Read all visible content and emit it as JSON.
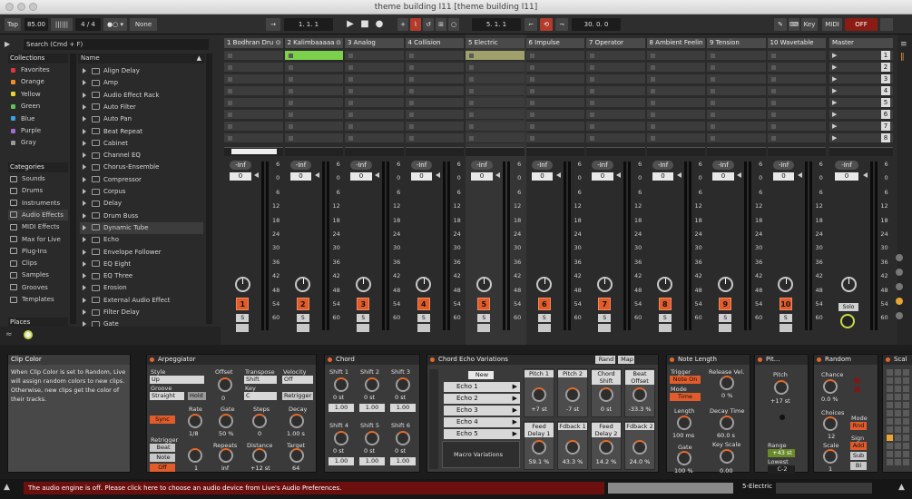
{
  "window": {
    "title": "theme building l11  [theme building l11]"
  },
  "toolbar": {
    "tap": "Tap",
    "tempo": "85.00",
    "signature": "4 / 4",
    "metro": "1 Bar",
    "quant": "None",
    "position": "1.  1.  1",
    "loop_start": "5.  1.  1",
    "loop_len": "30.  0.  0",
    "key": "Key",
    "midi": "MIDI",
    "cpu": "OFF"
  },
  "browser": {
    "search_placeholder": "Search (Cmd + F)",
    "collections_header": "Collections",
    "collections": [
      {
        "label": "Favorites",
        "color": "#e0353a"
      },
      {
        "label": "Orange",
        "color": "#f28c28"
      },
      {
        "label": "Yellow",
        "color": "#e8d234"
      },
      {
        "label": "Green",
        "color": "#5ec15a"
      },
      {
        "label": "Blue",
        "color": "#3aa0e8"
      },
      {
        "label": "Purple",
        "color": "#a56ad6"
      },
      {
        "label": "Gray",
        "color": "#9a9a9a"
      }
    ],
    "categories_header": "Categories",
    "categories": [
      {
        "label": "Sounds",
        "icon": "speaker-icon"
      },
      {
        "label": "Drums",
        "icon": "drum-icon"
      },
      {
        "label": "Instruments",
        "icon": "keyboard-icon"
      },
      {
        "label": "Audio Effects",
        "icon": "waveform-icon"
      },
      {
        "label": "MIDI Effects",
        "icon": "midi-icon"
      },
      {
        "label": "Max for Live",
        "icon": "max-icon"
      },
      {
        "label": "Plug-Ins",
        "icon": "plug-icon"
      },
      {
        "label": "Clips",
        "icon": "clip-icon"
      },
      {
        "label": "Samples",
        "icon": "sample-icon"
      },
      {
        "label": "Grooves",
        "icon": "groove-icon"
      },
      {
        "label": "Templates",
        "icon": "template-icon"
      }
    ],
    "places_header": "Places",
    "name_header": "Name",
    "items": [
      "Align Delay",
      "Amp",
      "Audio Effect Rack",
      "Auto Filter",
      "Auto Pan",
      "Beat Repeat",
      "Cabinet",
      "Channel EQ",
      "Chorus-Ensemble",
      "Compressor",
      "Corpus",
      "Delay",
      "Drum Buss",
      "Dynamic Tube",
      "Echo",
      "Envelope Follower",
      "EQ Eight",
      "EQ Three",
      "Erosion",
      "External Audio Effect",
      "Filter Delay",
      "Gate"
    ]
  },
  "tracks": [
    {
      "name": "1 Bodhran Dru",
      "num": "1"
    },
    {
      "name": "2 Kalimbaaaaa",
      "num": "2"
    },
    {
      "name": "3 Analog",
      "num": "3"
    },
    {
      "name": "4 Collision",
      "num": "4"
    },
    {
      "name": "5 Electric",
      "num": "5"
    },
    {
      "name": "6 Impulse",
      "num": "6"
    },
    {
      "name": "7 Operator",
      "num": "7"
    },
    {
      "name": "8 Ambient Feelin",
      "num": "8"
    },
    {
      "name": "9 Tension",
      "num": "9"
    },
    {
      "name": "10 Wavetable",
      "num": "10"
    }
  ],
  "master": {
    "name": "Master",
    "scenes": [
      "1",
      "2",
      "3",
      "4",
      "5",
      "6",
      "7",
      "8"
    ],
    "solo": "Solo"
  },
  "mixer": {
    "inf": "-Inf",
    "zero": "0",
    "scale": [
      "6",
      "0",
      "6",
      "12",
      "18",
      "24",
      "30",
      "36",
      "42",
      "48",
      "54",
      "60"
    ],
    "s": "S"
  },
  "info": {
    "title": "Clip Color",
    "text": "When Clip Color is set to Random, Live will assign random colors to new clips. Otherwise, new clips get the color of their tracks."
  },
  "arp": {
    "title": "Arpeggiator",
    "style_l": "Style",
    "style": "Up",
    "groove_l": "Groove",
    "groove": "Straight",
    "hold": "Hold",
    "offset_l": "Offset",
    "offset": "0",
    "transpose_l": "Transpose",
    "transpose": "Shift",
    "key_l": "Key",
    "key": "C",
    "velocity_l": "Velocity",
    "velocity": "Off",
    "retrig_btn": "Retrigger",
    "sync": "Sync",
    "rate_l": "Rate",
    "rate": "1/8",
    "gate_l": "Gate",
    "gate": "50 %",
    "steps_l": "Steps",
    "steps": "0",
    "decay_l": "Decay",
    "decay": "1.00 s",
    "retrigger_l": "Retrigger",
    "beat": "Beat",
    "note": "Note",
    "off": "Off",
    "r1": "1",
    "repeats_l": "Repeats",
    "repeats": "inf",
    "distance_l": "Distance",
    "distance": "+12 st",
    "target_l": "Target",
    "target": "64"
  },
  "chord": {
    "title": "Chord",
    "shifts": [
      {
        "l": "Shift 1",
        "v": "0 st",
        "f": "1.00"
      },
      {
        "l": "Shift 2",
        "v": "0 st",
        "f": "1.00"
      },
      {
        "l": "Shift 3",
        "v": "0 st",
        "f": "1.00"
      },
      {
        "l": "Shift 4",
        "v": "0 st",
        "f": "1.00"
      },
      {
        "l": "Shift 5",
        "v": "0 st",
        "f": "1.00"
      },
      {
        "l": "Shift 6",
        "v": "0 st",
        "f": "1.00"
      }
    ]
  },
  "rack": {
    "title": "Chord Echo Variations",
    "rand": "Rand",
    "map": "Map",
    "new": "New",
    "chains": [
      "Echo 1",
      "Echo 2",
      "Echo 3",
      "Echo 4",
      "Echo 5"
    ],
    "macro": "Macro Variations",
    "macros": [
      {
        "l": "Pitch 1",
        "v": "+7 st"
      },
      {
        "l": "Pitch 2",
        "v": "-7 st"
      },
      {
        "l": "Chord Shift",
        "v": "0 st"
      },
      {
        "l": "Beat Offset",
        "v": "-33.3 %"
      },
      {
        "l": "Feed Delay 1",
        "v": "59.1 %"
      },
      {
        "l": "Fdback 1",
        "v": "43.3 %"
      },
      {
        "l": "Feed Delay 2",
        "v": "14.2 %"
      },
      {
        "l": "Fdback 2",
        "v": "24.0 %"
      }
    ]
  },
  "notelen": {
    "title": "Note Length",
    "trigger_l": "Trigger",
    "trigger": "Note On",
    "mode_l": "Mode",
    "mode": "Time",
    "release_l": "Release Vel.",
    "release": "0 %",
    "length_l": "Length",
    "length": "100 ms",
    "decay_l": "Decay Time",
    "decay": "60.0 s",
    "gate_l": "Gate",
    "gate": "100 %",
    "keyscale_l": "Key Scale",
    "keyscale": "0.00"
  },
  "pitch": {
    "title": "Pit...",
    "pitch_l": "Pitch",
    "pitch": "+17 st",
    "range_l": "Range",
    "range": "+43 st",
    "lowest_l": "Lowest",
    "lowest": "C-2"
  },
  "random": {
    "title": "Random",
    "chance_l": "Chance",
    "chance": "0.0 %",
    "choices_l": "Choices",
    "choices": "12",
    "scale_l": "Scale",
    "scale": "1",
    "mode_l": "Mode",
    "mode": "Rnd",
    "sign_l": "Sign",
    "add": "Add",
    "sub": "Sub",
    "bi": "Bi",
    "alt": "Alt"
  },
  "scale_dev": {
    "title": "Scal"
  },
  "status": {
    "message": "The audio engine is off. Please click here to choose an audio device from Live's Audio Preferences.",
    "track": "5-Electric"
  }
}
